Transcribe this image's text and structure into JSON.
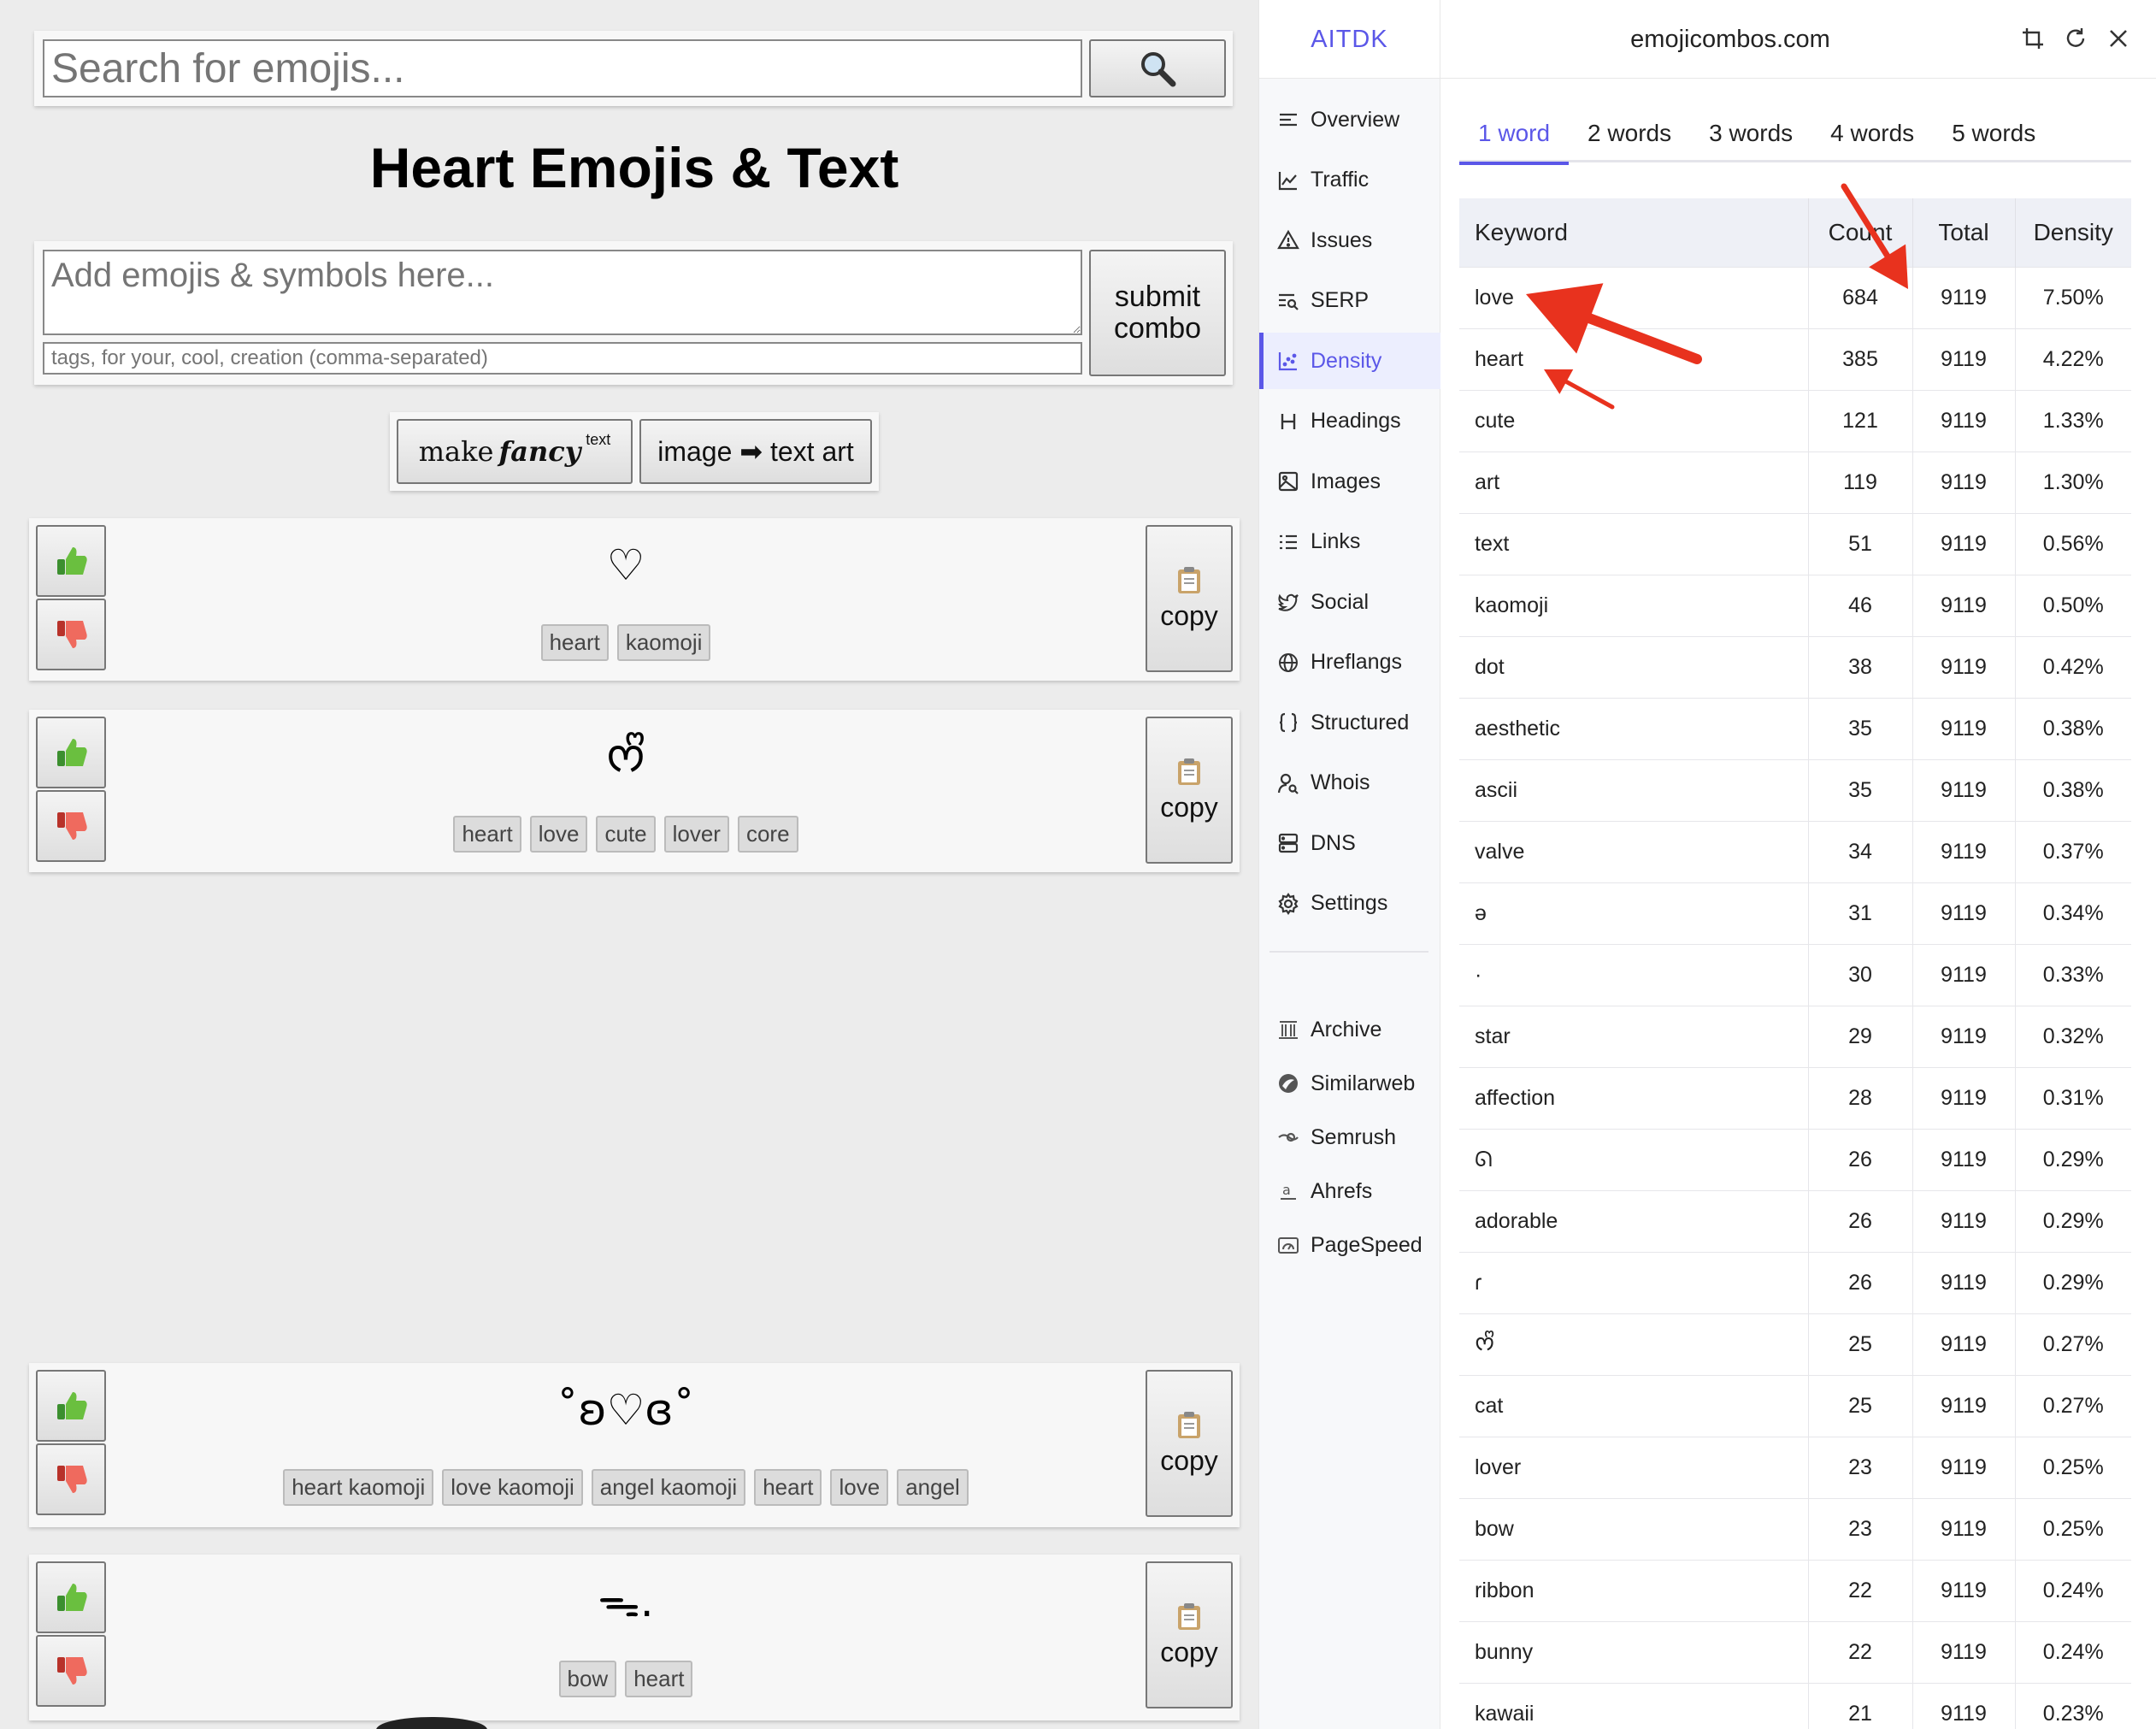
{
  "site": {
    "search": {
      "placeholder": "Search for emojis..."
    },
    "title": "Heart Emojis & Text",
    "add_form": {
      "combo_placeholder": "Add emojis & symbols here...",
      "tags_placeholder": "tags, for your, cool, creation (comma-separated)",
      "submit_line1": "submit",
      "submit_line2": "combo"
    },
    "tools": {
      "fancy_make": "make",
      "fancy_word": "fancy",
      "fancy_text": "text",
      "image_art": "image ➡ text art"
    },
    "copy_label": "copy",
    "cards": [
      {
        "combo": "♡",
        "tags": [
          "heart",
          "kaomoji"
        ]
      },
      {
        "combo": "ᰔᩚ",
        "tags": [
          "heart",
          "love",
          "cute",
          "lover",
          "core"
        ]
      },
      {
        "combo": "˚ʚ♡ɞ˚",
        "tags": [
          "heart kaomoji",
          "love kaomoji",
          "angel kaomoji",
          "heart",
          "love",
          "angel"
        ]
      },
      {
        "combo": "ᯓ.",
        "tags": [
          "bow",
          "heart"
        ]
      }
    ]
  },
  "extension": {
    "brand": "AITDK",
    "domain": "emojicombos.com",
    "nav": [
      {
        "label": "Overview",
        "icon": "overview-icon"
      },
      {
        "label": "Traffic",
        "icon": "traffic-chart-icon"
      },
      {
        "label": "Issues",
        "icon": "warning-triangle-icon"
      },
      {
        "label": "SERP",
        "icon": "serp-icon"
      },
      {
        "label": "Density",
        "icon": "density-scatter-icon",
        "active": true
      },
      {
        "label": "Headings",
        "icon": "heading-h-icon"
      },
      {
        "label": "Images",
        "icon": "image-icon"
      },
      {
        "label": "Links",
        "icon": "list-links-icon"
      },
      {
        "label": "Social",
        "icon": "twitter-bird-icon"
      },
      {
        "label": "Hreflangs",
        "icon": "globe-icon"
      },
      {
        "label": "Structured",
        "icon": "braces-icon"
      },
      {
        "label": "Whois",
        "icon": "user-search-icon"
      },
      {
        "label": "DNS",
        "icon": "server-icon"
      },
      {
        "label": "Settings",
        "icon": "gear-icon"
      }
    ],
    "external": [
      {
        "label": "Archive",
        "icon": "archive-icon"
      },
      {
        "label": "Similarweb",
        "icon": "similarweb-icon"
      },
      {
        "label": "Semrush",
        "icon": "semrush-icon"
      },
      {
        "label": "Ahrefs",
        "icon": "ahrefs-icon"
      },
      {
        "label": "PageSpeed",
        "icon": "pagespeed-icon"
      }
    ],
    "word_tabs": [
      "1 word",
      "2 words",
      "3 words",
      "4 words",
      "5 words"
    ],
    "active_word_tab": 0,
    "table": {
      "headers": [
        "Keyword",
        "Count",
        "Total",
        "Density"
      ],
      "rows": [
        [
          "love",
          "684",
          "9119",
          "7.50%"
        ],
        [
          "heart",
          "385",
          "9119",
          "4.22%"
        ],
        [
          "cute",
          "121",
          "9119",
          "1.33%"
        ],
        [
          "art",
          "119",
          "9119",
          "1.30%"
        ],
        [
          "text",
          "51",
          "9119",
          "0.56%"
        ],
        [
          "kaomoji",
          "46",
          "9119",
          "0.50%"
        ],
        [
          "dot",
          "38",
          "9119",
          "0.42%"
        ],
        [
          "aesthetic",
          "35",
          "9119",
          "0.38%"
        ],
        [
          "ascii",
          "35",
          "9119",
          "0.38%"
        ],
        [
          "valve",
          "34",
          "9119",
          "0.37%"
        ],
        [
          "ə",
          "31",
          "9119",
          "0.34%"
        ],
        [
          "·",
          "30",
          "9119",
          "0.33%"
        ],
        [
          "star",
          "29",
          "9119",
          "0.32%"
        ],
        [
          "affection",
          "28",
          "9119",
          "0.31%"
        ],
        [
          "ᘏ",
          "26",
          "9119",
          "0.29%"
        ],
        [
          "adorable",
          "26",
          "9119",
          "0.29%"
        ],
        [
          "ɾ",
          "26",
          "9119",
          "0.29%"
        ],
        [
          "ᰔᩚ",
          "25",
          "9119",
          "0.27%"
        ],
        [
          "cat",
          "25",
          "9119",
          "0.27%"
        ],
        [
          "lover",
          "23",
          "9119",
          "0.25%"
        ],
        [
          "bow",
          "23",
          "9119",
          "0.25%"
        ],
        [
          "ribbon",
          "22",
          "9119",
          "0.24%"
        ],
        [
          "bunny",
          "22",
          "9119",
          "0.24%"
        ],
        [
          "kawaii",
          "21",
          "9119",
          "0.23%"
        ]
      ]
    }
  },
  "annotations": {
    "arrow_color": "#e8321e"
  }
}
